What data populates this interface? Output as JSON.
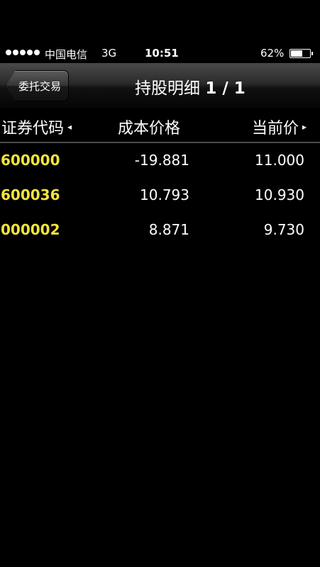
{
  "status_bar": {
    "carrier": "中国电信",
    "network": "3G",
    "time": "10:51",
    "battery_percent_text": "62%",
    "battery_level": 0.62
  },
  "nav": {
    "back_label": "委托交易",
    "title": "持股明细",
    "page_indicator": "1 / 1"
  },
  "table": {
    "headers": [
      {
        "label": "证券代码",
        "arrow": "◂"
      },
      {
        "label": "成本价格",
        "arrow": ""
      },
      {
        "label": "当前价",
        "arrow": "▸"
      }
    ],
    "rows": [
      {
        "code": "600000",
        "cost": "-19.881",
        "price": "11.000"
      },
      {
        "code": "600036",
        "cost": "10.793",
        "price": "10.930"
      },
      {
        "code": "000002",
        "cost": "8.871",
        "price": "9.730"
      }
    ]
  },
  "colors": {
    "code_text": "#f2e43a",
    "background": "#000000"
  }
}
